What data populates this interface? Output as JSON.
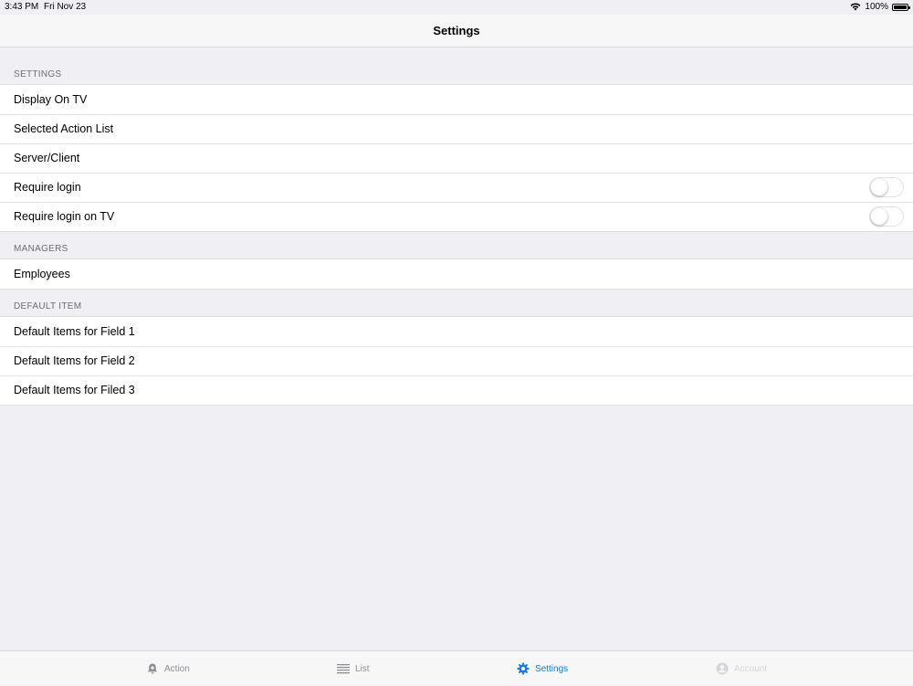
{
  "status": {
    "time": "3:43 PM",
    "date": "Fri Nov 23",
    "battery": "100%"
  },
  "nav": {
    "title": "Settings"
  },
  "sections": {
    "settings": {
      "header": "SETTINGS",
      "rows": [
        "Display On TV",
        "Selected Action List",
        "Server/Client",
        "Require login",
        "Require login on TV"
      ]
    },
    "managers": {
      "header": "MANAGERS",
      "rows": [
        "Employees"
      ]
    },
    "default_item": {
      "header": "DEFAULT ITEM",
      "rows": [
        "Default Items for Field 1",
        "Default Items for Field 2",
        "Default Items for Filed 3"
      ]
    }
  },
  "toggles": {
    "require_login": false,
    "require_login_tv": false
  },
  "tabs": {
    "action": "Action",
    "list": "List",
    "settings": "Settings",
    "account": "Account"
  },
  "colors": {
    "accent": "#1a7be0",
    "background": "#efeff4"
  }
}
